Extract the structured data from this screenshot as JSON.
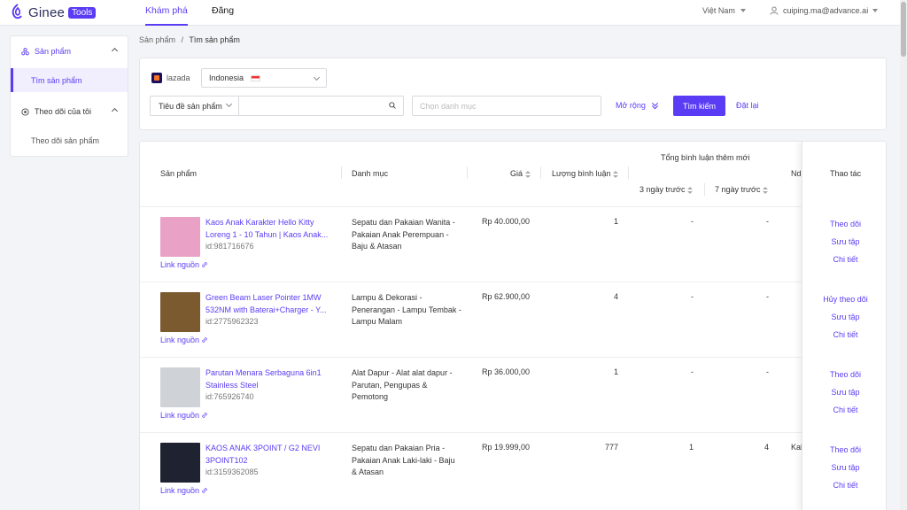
{
  "app": {
    "logo_text": "Ginee",
    "logo_badge": "Tools"
  },
  "nav": {
    "tabs": [
      {
        "label": "Khám phá",
        "active": true
      },
      {
        "label": "Đăng",
        "active": false
      }
    ]
  },
  "header": {
    "language": "Việt Nam",
    "user_email": "cuiping.ma@advance.ai"
  },
  "sidebar": {
    "groups": [
      {
        "label": "Sản phẩm",
        "items": [
          {
            "label": "Tìm sản phẩm",
            "active": true
          }
        ]
      },
      {
        "label": "Theo dõi của tôi",
        "items": [
          {
            "label": "Theo dõi sản phẩm",
            "active": false
          }
        ]
      }
    ]
  },
  "breadcrumb": {
    "parent": "Sản phẩm",
    "separator": "/",
    "current": "Tìm sản phẩm"
  },
  "filters": {
    "platform": "lazada",
    "country": "Indonesia",
    "search_type": "Tiêu đề sản phẩm",
    "search_value": "",
    "category_placeholder": "Chọn danh mục",
    "expand_label": "Mở rộng",
    "search_button": "Tìm kiếm",
    "reset_button": "Đặt lại"
  },
  "table": {
    "headers": {
      "product": "Sản phẩm",
      "category": "Danh mục",
      "price": "Giá",
      "reviews": "Lượng bình luận",
      "new_reviews_group": "Tổng bình luận thêm mới",
      "days3": "3 ngày trước",
      "days7": "7 ngày trước",
      "partial": "Ndi",
      "actions": "Thao tác"
    },
    "source_link_label": "Link nguồn",
    "rows": [
      {
        "name": "Kaos Anak Karakter Hello Kitty Loreng 1 - 10 Tahun | Kaos Anak...",
        "id": "id:981716676",
        "category": "Sepatu dan Pakaian Wanita - Pakaian Anak Perempuan - Baju & Atasan",
        "price": "Rp 40.000,00",
        "reviews": "1",
        "d3": "-",
        "d7": "-",
        "extra": "",
        "actions": [
          "Theo dõi",
          "Sưu tập",
          "Chi tiết"
        ],
        "thumb_color": "#e9a2c6"
      },
      {
        "name": "Green Beam Laser Pointer 1MW 532NM with Baterai+Charger - Y...",
        "id": "id:2775962323",
        "category": "Lampu & Dekorasi - Penerangan - Lampu Tembak - Lampu Malam",
        "price": "Rp 62.900,00",
        "reviews": "4",
        "d3": "-",
        "d7": "-",
        "extra": "",
        "actions": [
          "Hủy theo dõi",
          "Sưu tập",
          "Chi tiết"
        ],
        "thumb_color": "#7a5a2e"
      },
      {
        "name": "Parutan Menara Serbaguna 6in1 Stainless Steel",
        "id": "id:765926740",
        "category": "Alat Dapur - Alat alat dapur - Parutan, Pengupas & Pemotong",
        "price": "Rp 36.000,00",
        "reviews": "1",
        "d3": "-",
        "d7": "-",
        "extra": "",
        "actions": [
          "Theo dõi",
          "Sưu tập",
          "Chi tiết"
        ],
        "thumb_color": "#cfd2d6"
      },
      {
        "name": "KAOS ANAK 3POINT / G2 NEVI 3POINT102",
        "id": "id:3159362085",
        "category": "Sepatu dan Pakaian Pria - Pakaian Anak Laki-laki - Baju & Atasan",
        "price": "Rp 19.999,00",
        "reviews": "777",
        "d3": "1",
        "d7": "4",
        "extra": "Kab",
        "actions": [
          "Theo dõi",
          "Sưu tập",
          "Chi tiết"
        ],
        "thumb_color": "#1f2230"
      }
    ]
  }
}
